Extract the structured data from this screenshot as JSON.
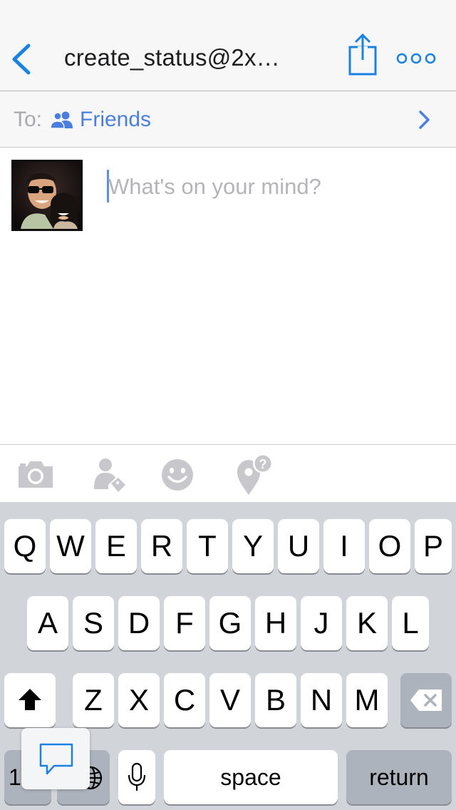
{
  "navbar": {
    "title": "create_status@2x…",
    "back_icon": "chevron-left-icon",
    "share_icon": "share-icon",
    "more_icon": "more-dots-icon",
    "accent_color": "#1a82e2"
  },
  "audience": {
    "to_label": "To:",
    "selected": "Friends",
    "icon": "friends-icon",
    "color": "#4a7fe0"
  },
  "composer": {
    "placeholder": "What's on your mind?",
    "value": ""
  },
  "toolbar": {
    "items": [
      {
        "icon": "camera-icon"
      },
      {
        "icon": "tag-person-icon"
      },
      {
        "icon": "smiley-icon"
      },
      {
        "icon": "location-question-icon"
      }
    ]
  },
  "keyboard": {
    "row1": [
      "Q",
      "W",
      "E",
      "R",
      "T",
      "Y",
      "U",
      "I",
      "O",
      "P"
    ],
    "row2": [
      "A",
      "S",
      "D",
      "F",
      "G",
      "H",
      "J",
      "K",
      "L"
    ],
    "row3": [
      "Z",
      "X",
      "C",
      "V",
      "B",
      "N",
      "M"
    ],
    "numbers_key": "123",
    "space": "space",
    "return": "return",
    "shift_icon": "shift-icon",
    "delete_icon": "delete-icon",
    "globe_icon": "globe-icon",
    "mic_icon": "microphone-icon",
    "popover_icon": "chat-bubble-icon"
  }
}
